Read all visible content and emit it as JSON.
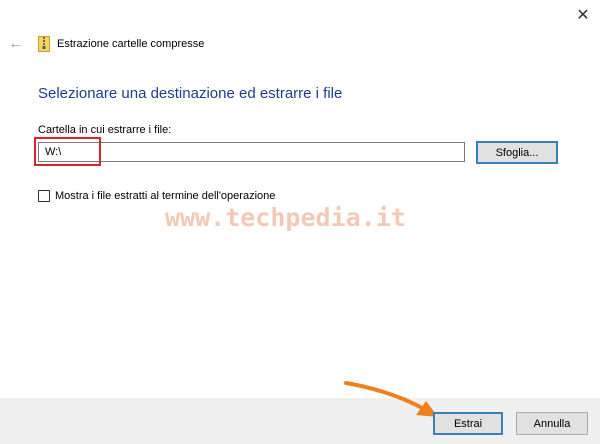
{
  "window": {
    "title": "Estrazione cartelle compresse",
    "close_glyph": "✕",
    "back_glyph": "←"
  },
  "main": {
    "heading": "Selezionare una destinazione ed estrarre i file",
    "field_label": "Cartella in cui estrarre i file:",
    "path_value": "W:\\",
    "browse_label": "Sfoglia...",
    "checkbox_label": "Mostra i file estratti al termine dell'operazione",
    "checkbox_checked": false
  },
  "watermark": {
    "text": "www.techpedia.it"
  },
  "footer": {
    "extract_label": "Estrai",
    "cancel_label": "Annulla"
  },
  "colors": {
    "heading": "#1e3d8f",
    "highlight": "#d9262e",
    "arrow": "#f07f1e",
    "focus_border": "#3c7fb1"
  }
}
